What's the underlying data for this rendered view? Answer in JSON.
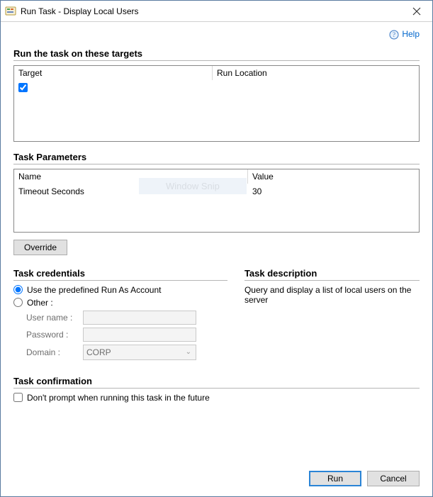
{
  "window": {
    "title": "Run Task - Display Local Users"
  },
  "help": {
    "label": "Help"
  },
  "targets": {
    "heading": "Run the task on these targets",
    "col_target": "Target",
    "col_location": "Run Location",
    "rows": [
      {
        "checked": true,
        "target": "",
        "location": ""
      }
    ]
  },
  "ghost": "Window Snip",
  "params": {
    "heading": "Task Parameters",
    "col_name": "Name",
    "col_value": "Value",
    "rows": [
      {
        "name": "Timeout Seconds",
        "value": "30"
      }
    ]
  },
  "override_label": "Override",
  "credentials": {
    "heading": "Task credentials",
    "predefined_label": "Use the predefined Run As Account",
    "other_label": "Other :",
    "username_label": "User name :",
    "password_label": "Password :",
    "domain_label": "Domain :",
    "username_value": "",
    "password_value": "",
    "domain_value": "CORP"
  },
  "description": {
    "heading": "Task description",
    "text": "Query and display a list of local users on the server"
  },
  "confirmation": {
    "heading": "Task confirmation",
    "checkbox_label": "Don't prompt when running this task in the future"
  },
  "buttons": {
    "run": "Run",
    "cancel": "Cancel"
  }
}
